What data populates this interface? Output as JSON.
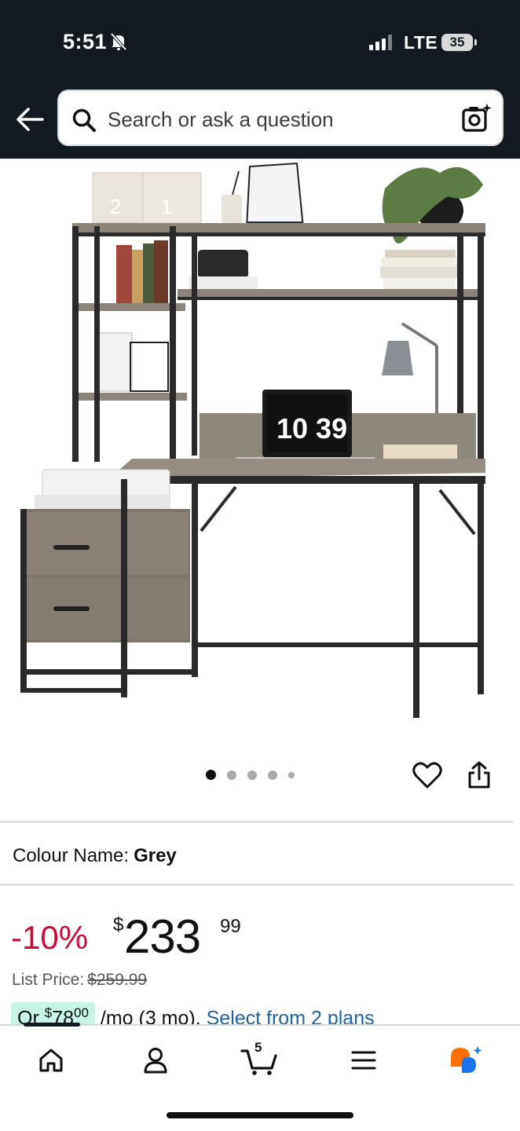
{
  "status_bar": {
    "time": "5:51",
    "network": "LTE",
    "battery": "35"
  },
  "header": {
    "search_placeholder": "Search or ask a question"
  },
  "product_image": {
    "clock_display": "10 39",
    "image_count": 5,
    "active_image": 1
  },
  "product": {
    "colour_label": "Colour Name:",
    "colour_value": "Grey",
    "discount": "-10%",
    "currency_symbol": "$",
    "price_whole": "233",
    "price_fraction": "99",
    "list_price_label": "List Price:",
    "list_price": "$259.99",
    "installment_prefix": "Or ",
    "installment_currency": "$",
    "installment_whole": "78",
    "installment_fraction": "00",
    "installment_term": " /mo (3 mo). ",
    "installment_link": "Select from 2 plans"
  },
  "tabbar": {
    "cart_count": "5",
    "items": [
      "home-icon",
      "account-icon",
      "cart-icon",
      "menu-icon",
      "rufus-icon"
    ]
  },
  "colors": {
    "header_bg": "#131a22",
    "discount_red": "#cc0c39",
    "link_blue": "#2162a1",
    "installment_badge": "#c8f3e6"
  }
}
